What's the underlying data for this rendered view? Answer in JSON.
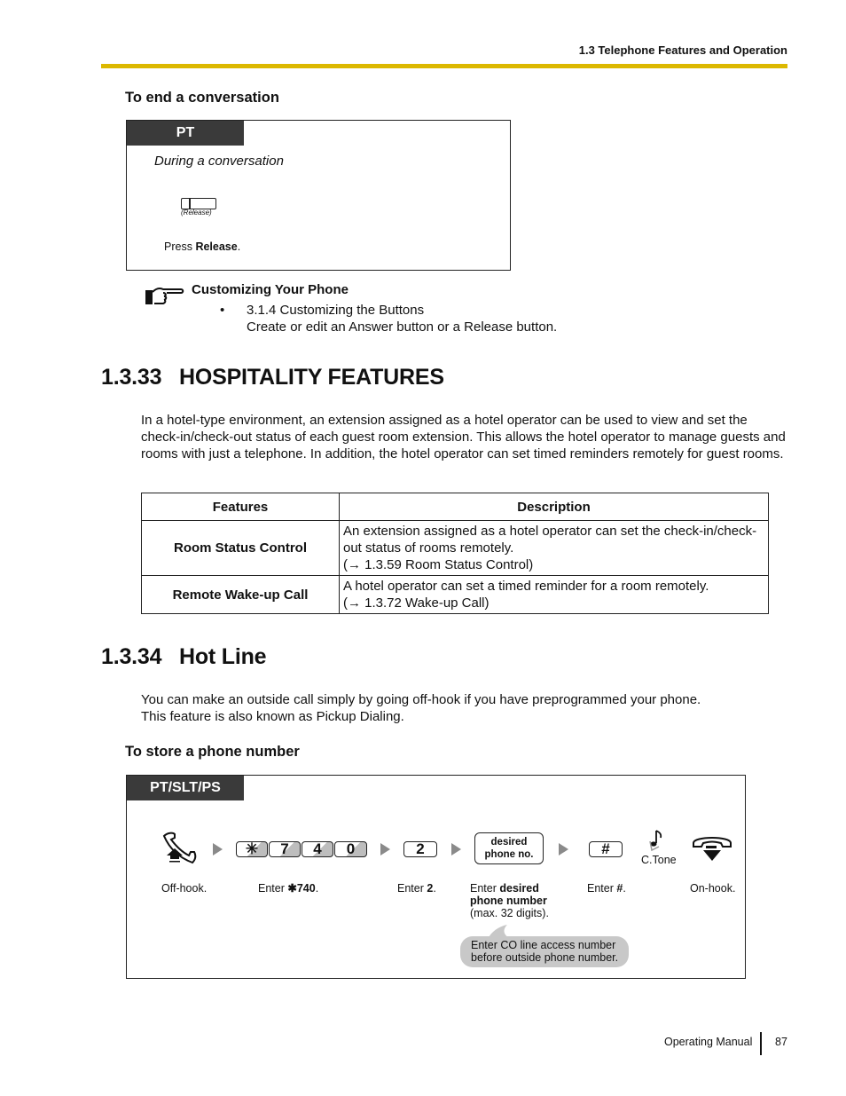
{
  "header": {
    "running_title": "1.3 Telephone Features and Operation",
    "rule_color": "#dcb800"
  },
  "end_conversation": {
    "heading": "To end a conversation",
    "box": {
      "tab_label": "PT",
      "context": "During a conversation",
      "button_caption": "(Release)",
      "instruction_prefix": "Press ",
      "instruction_bold": "Release",
      "instruction_suffix": "."
    }
  },
  "customize_note": {
    "icon": "pointing-hand-icon",
    "title": "Customizing Your Phone",
    "bullet": "•",
    "item_title": "3.1.4 Customizing the Buttons",
    "item_desc": "Create or edit an Answer button or a Release button."
  },
  "section_hospitality": {
    "number": "1.3.33",
    "title": "HOSPITALITY FEATURES",
    "intro": "In a hotel-type environment, an extension assigned as a hotel operator can be used to view and set the check-in/check-out status of each guest room extension. This allows the hotel operator to manage guests and rooms with just a telephone. In addition, the hotel operator can set timed reminders remotely for guest rooms.",
    "table": {
      "headers": [
        "Features",
        "Description"
      ],
      "rows": [
        {
          "feature": "Room Status Control",
          "desc_lines": [
            "An extension assigned as a hotel operator can set the check-in/check-",
            "out status of rooms remotely.",
            "(→ 1.3.59 Room Status Control)"
          ]
        },
        {
          "feature": "Remote Wake-up Call",
          "desc_lines": [
            "A hotel operator can set a timed reminder for a room remotely.",
            "(→ 1.3.72 Wake-up Call)"
          ]
        }
      ]
    }
  },
  "section_hotline": {
    "number": "1.3.34",
    "title": "Hot Line",
    "intro_lines": [
      "You can make an outside call simply by going off-hook if you have preprogrammed your phone.",
      "This feature is also known as Pickup Dialing."
    ],
    "subheading": "To store a phone number",
    "box": {
      "tab_label": "PT/SLT/PS",
      "keys": {
        "k1": "✳",
        "k2": "7",
        "k3": "4",
        "k4": "0",
        "k5": "2",
        "k6_line1": "desired",
        "k6_line2": "phone no.",
        "k7": "#"
      },
      "tone_label": "C.Tone",
      "steps": {
        "offhook": "Off-hook.",
        "enter_code_prefix": "Enter ",
        "enter_code_bold": "✱740",
        "enter_code_suffix": ".",
        "enter_2_prefix": "Enter ",
        "enter_2_bold": "2",
        "enter_2_suffix": ".",
        "enter_num_prefix": "Enter ",
        "enter_num_bold1": "desired",
        "enter_num_bold2": "phone number",
        "enter_num_note": "(max. 32 digits).",
        "enter_hash_prefix": "Enter ",
        "enter_hash_bold": "#",
        "enter_hash_suffix": ".",
        "onhook": "On-hook."
      },
      "bubble_line1": "Enter CO line access number",
      "bubble_line2": "before outside phone number."
    }
  },
  "footer": {
    "label": "Operating Manual",
    "page": "87"
  }
}
